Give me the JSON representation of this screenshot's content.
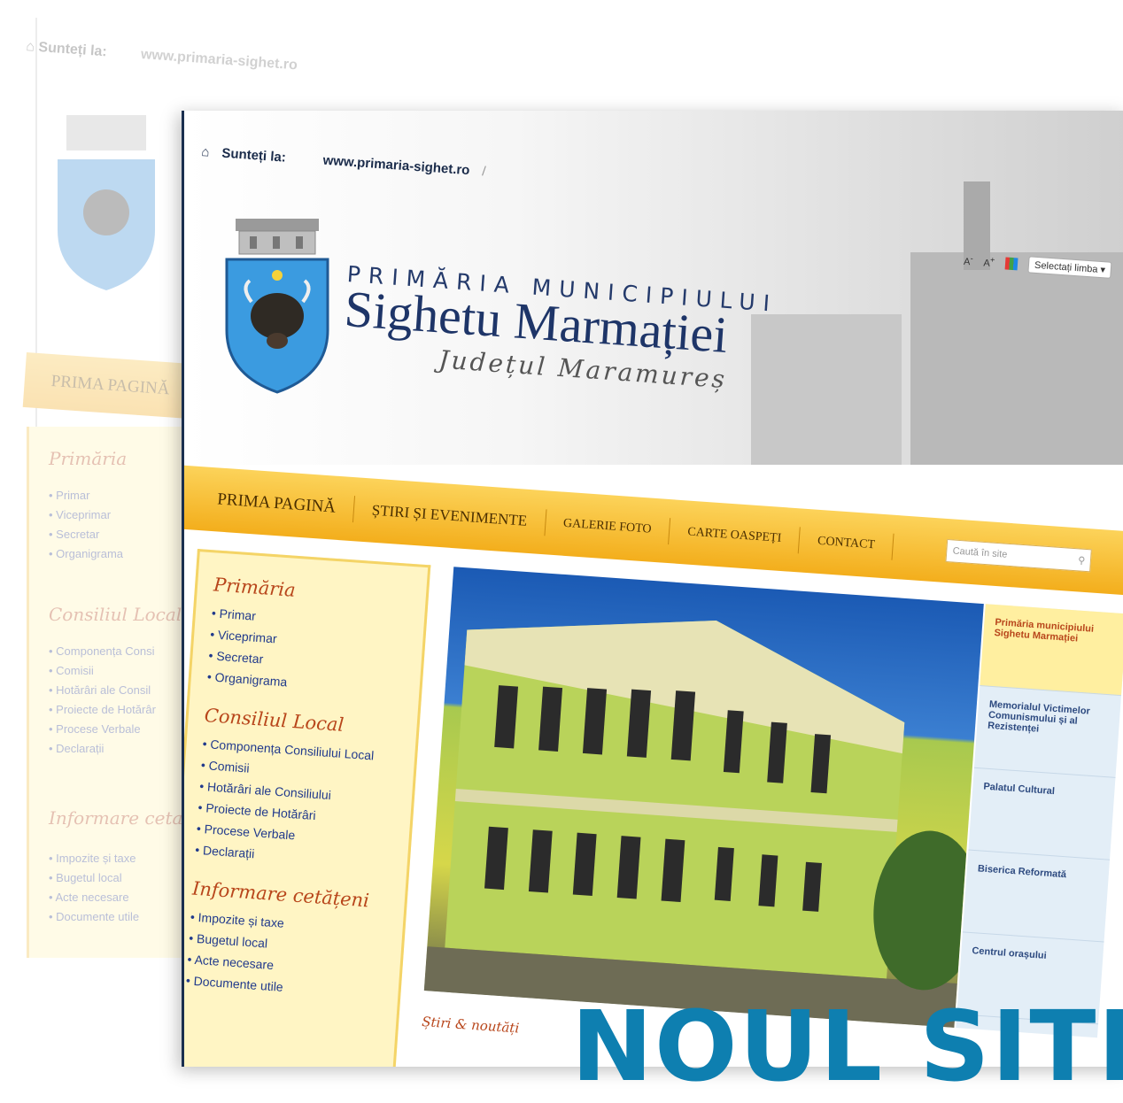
{
  "back_window": {
    "breadcrumb_label": "Sunteți la:",
    "breadcrumb_url": "www.primaria-sighet.ro",
    "nav_first": "PRIMA PAGINĂ",
    "sections": [
      {
        "heading": "Primăria",
        "items": [
          "Primar",
          "Viceprimar",
          "Secretar",
          "Organigrama"
        ]
      },
      {
        "heading": "Consiliul Local",
        "items": [
          "Componența Consi",
          "Comisii",
          "Hotărâri ale Consil",
          "Proiecte de Hotărâr",
          "Procese Verbale",
          "Declarații"
        ]
      },
      {
        "heading": "Informare ceta",
        "items": [
          "Impozite și taxe",
          "Bugetul local",
          "Acte necesare",
          "Documente utile"
        ]
      }
    ]
  },
  "breadcrumb": {
    "label": "Sunteți la:",
    "url": "www.primaria-sighet.ro",
    "separator": "/"
  },
  "header": {
    "line1": "PRIMĂRIA MUNICIPIULUI",
    "line2": "Sighetu Marmației",
    "line3": "Județul Maramureș",
    "font_small": "A",
    "font_large": "A",
    "language_select": "Selectați limba"
  },
  "nav": {
    "items": [
      "PRIMA PAGINĂ",
      "ȘTIRI ȘI EVENIMENTE",
      "GALERIE FOTO",
      "CARTE OASPEȚI",
      "CONTACT"
    ],
    "search_placeholder": "Caută în site"
  },
  "sidebar": {
    "sections": [
      {
        "heading": "Primăria",
        "items": [
          "Primar",
          "Viceprimar",
          "Secretar",
          "Organigrama"
        ]
      },
      {
        "heading": "Consiliul Local",
        "items": [
          "Componența Consiliului Local",
          "Comisii",
          "Hotărâri ale Consiliului",
          "Proiecte de Hotărâri",
          "Procese Verbale",
          "Declarații"
        ]
      },
      {
        "heading": "Informare cetățeni",
        "items": [
          "Impozite și taxe",
          "Bugetul local",
          "Acte necesare",
          "Documente utile"
        ]
      }
    ]
  },
  "gallery": {
    "items": [
      "Primăria municipiului Sighetu Marmației",
      "Memorialul Victimelor Comunismului și al Rezistenței",
      "Palatul Cultural",
      "Biserica Reformată",
      "Centrul orașului"
    ],
    "active_index": 0
  },
  "news": {
    "title": "Știri & noutăți"
  },
  "banner": {
    "text": "NOUL SITE"
  },
  "colors": {
    "nav_yellow": "#f3ae1c",
    "sidebar_bg": "#fff5c4",
    "heading_rust": "#b8461b",
    "link_blue": "#213a8c",
    "banner_blue": "#0e7fb0"
  },
  "icons": [
    "home-icon",
    "search-icon",
    "coat-of-arms",
    "translate-icon"
  ]
}
